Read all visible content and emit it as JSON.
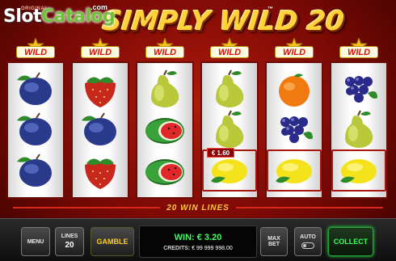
{
  "watermark": {
    "part1": "Slot",
    "part2": "Catalog",
    "suffix": ".com"
  },
  "game": {
    "title": "SIMPLY WILD 20",
    "trademark": "™",
    "original": "ORIGINAL"
  },
  "reels": [
    {
      "wild": "WILD",
      "symbols": [
        "plum",
        "plum",
        "plum"
      ]
    },
    {
      "wild": "WILD",
      "symbols": [
        "strawberry",
        "plum",
        "strawberry"
      ]
    },
    {
      "wild": "WILD",
      "symbols": [
        "pear",
        "watermelon",
        "watermelon"
      ]
    },
    {
      "wild": "WILD",
      "symbols": [
        "pear",
        "pear",
        "lemon"
      ]
    },
    {
      "wild": "WILD",
      "symbols": [
        "orange",
        "grapes",
        "lemon"
      ]
    },
    {
      "wild": "WILD",
      "symbols": [
        "grapes",
        "pear",
        "lemon"
      ]
    }
  ],
  "winning_cells": [
    [
      3,
      2
    ],
    [
      4,
      2
    ],
    [
      5,
      2
    ]
  ],
  "line_win_tag": "€ 1.60",
  "win_lines_label": "20 WIN LINES",
  "controls": {
    "menu": "MENU",
    "lines_label": "LINES",
    "lines_value": "20",
    "gamble": "GAMBLE",
    "win_text": "WIN: € 3.20",
    "credits_label": "CREDITS:",
    "credits_value": "€ 99 999 998.00",
    "max_bet_line1": "MAX",
    "max_bet_line2": "BET",
    "auto": "AUTO",
    "collect": "COLLECT"
  },
  "colors": {
    "background": "#7a0905",
    "title": "#ffd23a",
    "win": "#3dff5c",
    "gamble": "#ffcc1a",
    "wild_text": "#d2100c"
  }
}
